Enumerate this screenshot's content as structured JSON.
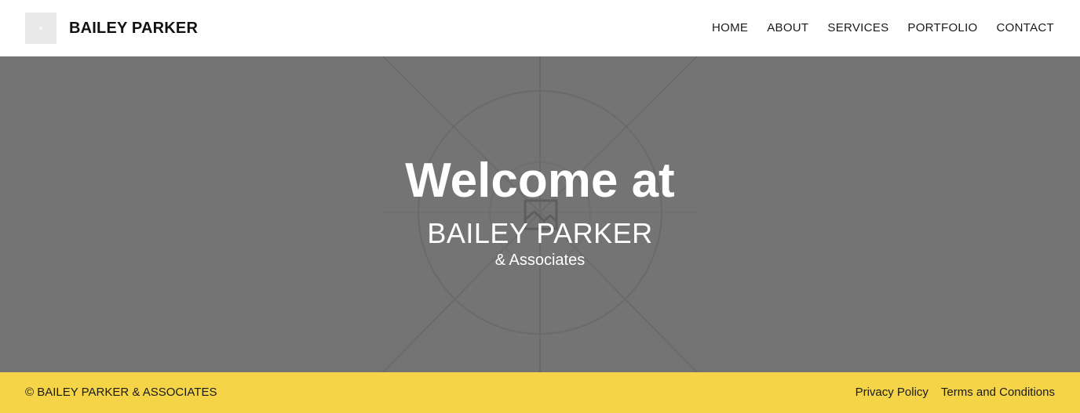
{
  "header": {
    "logo_icon": "image-placeholder-icon",
    "brand": "BAILEY PARKER",
    "nav": [
      {
        "label": "HOME"
      },
      {
        "label": "ABOUT"
      },
      {
        "label": "SERVICES"
      },
      {
        "label": "PORTFOLIO"
      },
      {
        "label": "CONTACT"
      }
    ]
  },
  "hero": {
    "background_icon": "image-placeholder-icon",
    "title": "Welcome at",
    "subtitle": "BAILEY PARKER",
    "tagline": "& Associates"
  },
  "footer": {
    "copyright": "© BAILEY PARKER & ASSOCIATES",
    "links": [
      {
        "label": "Privacy Policy"
      },
      {
        "label": "Terms and Conditions"
      }
    ]
  },
  "colors": {
    "hero_background": "#747474",
    "footer_background": "#f5d547",
    "header_background": "#ffffff",
    "text_dark": "#1a1a1a",
    "text_light": "#ffffff"
  }
}
